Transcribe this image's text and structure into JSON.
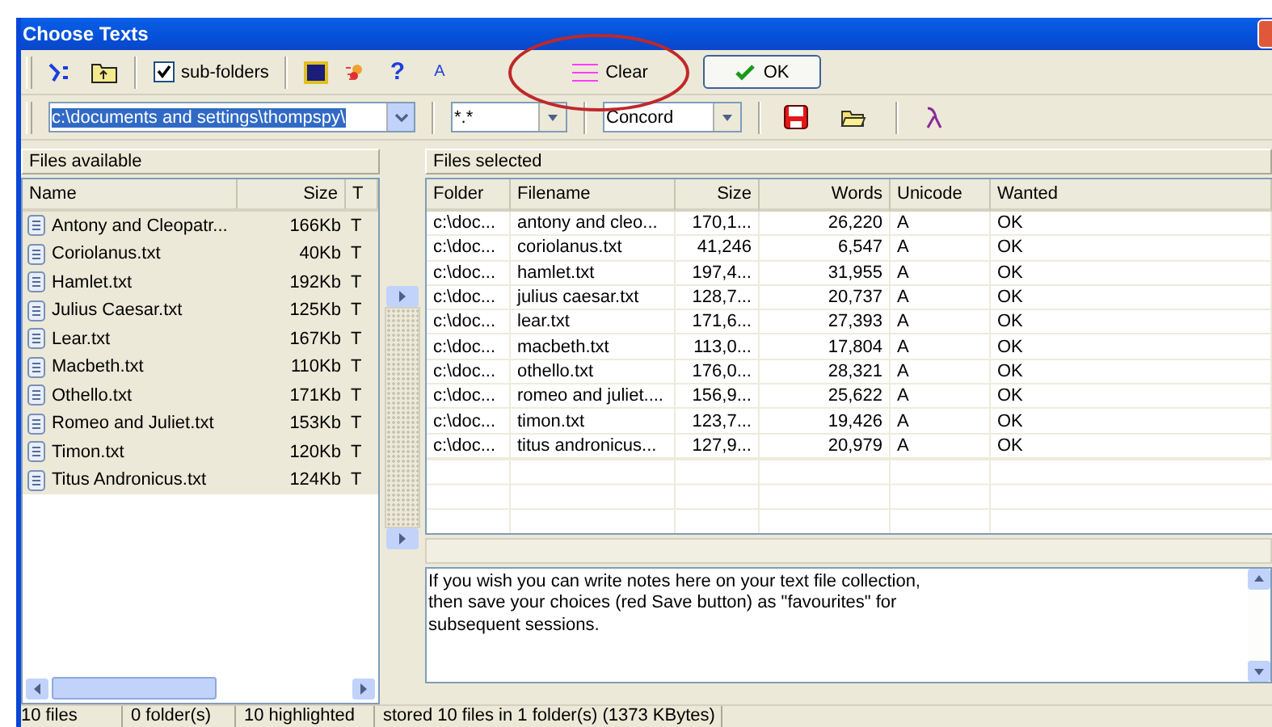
{
  "window": {
    "title": "Choose Texts"
  },
  "toolbar": {
    "subfolders": {
      "label": "sub-folders",
      "checked": true
    },
    "glyphs": [
      "?",
      "A"
    ],
    "clear_button": "Clear",
    "ok_button": "OK"
  },
  "path_combo": {
    "value": "c:\\documents and settings\\thompspy\\"
  },
  "filter_combo": {
    "value": "*.*"
  },
  "program_combo": {
    "value": "Concord"
  },
  "files_available": {
    "title": "Files available",
    "columns": [
      "Name",
      "Size",
      "T"
    ],
    "rows": [
      {
        "name": "Antony and Cleopatr...",
        "size": "166Kb",
        "column_3": "T",
        "selected": true
      },
      {
        "name": "Coriolanus.txt",
        "size": "40Kb",
        "column_3": "T",
        "selected": true
      },
      {
        "name": "Hamlet.txt",
        "size": "192Kb",
        "column_3": "T",
        "selected": true
      },
      {
        "name": "Julius Caesar.txt",
        "size": "125Kb",
        "column_3": "T",
        "selected": true
      },
      {
        "name": "Lear.txt",
        "size": "167Kb",
        "column_3": "T",
        "selected": true
      },
      {
        "name": "Macbeth.txt",
        "size": "110Kb",
        "column_3": "T",
        "selected": true
      },
      {
        "name": "Othello.txt",
        "size": "171Kb",
        "column_3": "T",
        "selected": true
      },
      {
        "name": "Romeo and Juliet.txt",
        "size": "153Kb",
        "column_3": "T",
        "selected": true
      },
      {
        "name": "Timon.txt",
        "size": "120Kb",
        "column_3": "T",
        "selected": true
      },
      {
        "name": "Titus Andronicus.txt",
        "size": "124Kb",
        "column_3": "T",
        "selected": true
      }
    ]
  },
  "files_selected": {
    "title": "Files selected",
    "columns": [
      "Folder",
      "Filename",
      "Size",
      "Words",
      "Unicode",
      "Wanted"
    ],
    "rows": [
      [
        "c:\\doc...",
        "antony and cleo...",
        "170,1...",
        "26,220",
        "A",
        "OK"
      ],
      [
        "c:\\doc...",
        "coriolanus.txt",
        "41,246",
        "6,547",
        "A",
        "OK"
      ],
      [
        "c:\\doc...",
        "hamlet.txt",
        "197,4...",
        "31,955",
        "A",
        "OK"
      ],
      [
        "c:\\doc...",
        "julius caesar.txt",
        "128,7...",
        "20,737",
        "A",
        "OK"
      ],
      [
        "c:\\doc...",
        "lear.txt",
        "171,6...",
        "27,393",
        "A",
        "OK"
      ],
      [
        "c:\\doc...",
        "macbeth.txt",
        "113,0...",
        "17,804",
        "A",
        "OK"
      ],
      [
        "c:\\doc...",
        "othello.txt",
        "176,0...",
        "28,321",
        "A",
        "OK"
      ],
      [
        "c:\\doc...",
        "romeo and juliet....",
        "156,9...",
        "25,622",
        "A",
        "OK"
      ],
      [
        "c:\\doc...",
        "timon.txt",
        "123,7...",
        "19,426",
        "A",
        "OK"
      ],
      [
        "c:\\doc...",
        "titus andronicus...",
        "127,9...",
        "20,979",
        "A",
        "OK"
      ]
    ]
  },
  "notes": {
    "value": "If you wish you can write notes here on your text file collection,\nthen save your choices (red Save button) as \"favourites\" for\nsubsequent sessions."
  },
  "status_bar": [
    "10 files",
    "0 folder(s)",
    "10 highlighted",
    "stored 10 files in 1 folder(s) (1373 KBytes)"
  ]
}
